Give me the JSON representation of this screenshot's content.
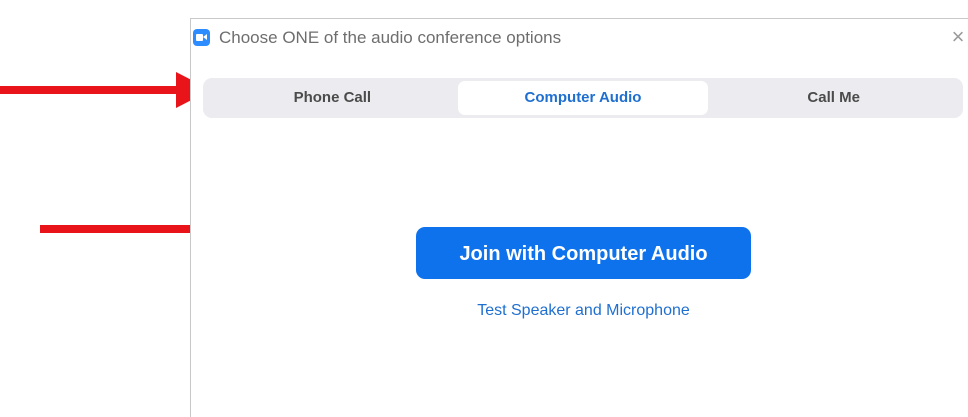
{
  "window": {
    "title": "Choose ONE of the audio conference options",
    "close_glyph": "×"
  },
  "tabs": [
    {
      "label": "Phone Call",
      "active": false
    },
    {
      "label": "Computer Audio",
      "active": true
    },
    {
      "label": "Call Me",
      "active": false
    }
  ],
  "actions": {
    "join_label": "Join with Computer Audio",
    "test_label": "Test Speaker and Microphone"
  },
  "colors": {
    "accent": "#0e72ed",
    "link": "#1f6fd0",
    "annotation_arrow": "#e8141a",
    "tab_bar": "#ececf0"
  },
  "icons": {
    "app": "zoom-camera-icon",
    "close": "close-icon",
    "annotation": "red-arrow-icon"
  }
}
